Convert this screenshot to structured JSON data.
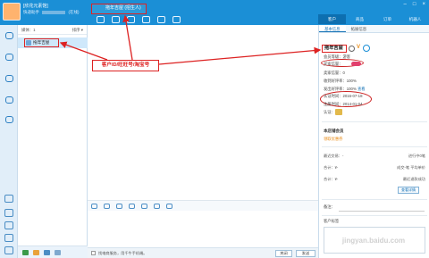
{
  "app": {
    "shop_name": "[欣花元素馆]",
    "shop_sub_prefix": "快递助手",
    "shop_sub_suffix": "(在线)"
  },
  "chat": {
    "title": "拖年吉屋 (招生人)"
  },
  "right_tabs": [
    "客户",
    "商品",
    "订单",
    "机器人"
  ],
  "contact_list": {
    "header_left": "媒体：1",
    "header_right": "排序 ▾",
    "selected_contact": "拖年吉屋"
  },
  "annotation": {
    "label": "客户ID/旺旺号/淘宝号"
  },
  "right_panel": {
    "subtabs": [
      "基本信息",
      "拓展信息"
    ],
    "name": "拖年吉屋",
    "membership": "会员等级：游客",
    "buyer_credit": "买家信誉：",
    "seller_credit": "卖家信誉：0",
    "good_rate_received": "收到好评率：100%",
    "good_rate_given": "发出好评率：100%",
    "good_rate_link": "查看",
    "certified_time": "认证时间：2016-07-18",
    "register_time": "注册时间：2014-01-04",
    "verify": "认证：",
    "section_title": "本店铺会员",
    "section_link": "领取优惠券",
    "recent_deal_label": "最近交易：-",
    "recent_deal_value": "进行中0笔",
    "total_label": "合计：¥-",
    "total_value": "成交-笔 平均单价",
    "total2_label": "合计：¥-",
    "total2_value": "最近退款成功",
    "button": "查看详情",
    "note_label": "备注：",
    "tag_label": "客户标签"
  },
  "chat_footer": {
    "tip": "找电商服务，用千牛手机端。",
    "close_button": "关闭",
    "send_button": "发送"
  },
  "watermark": "jingyan.baidu.com"
}
